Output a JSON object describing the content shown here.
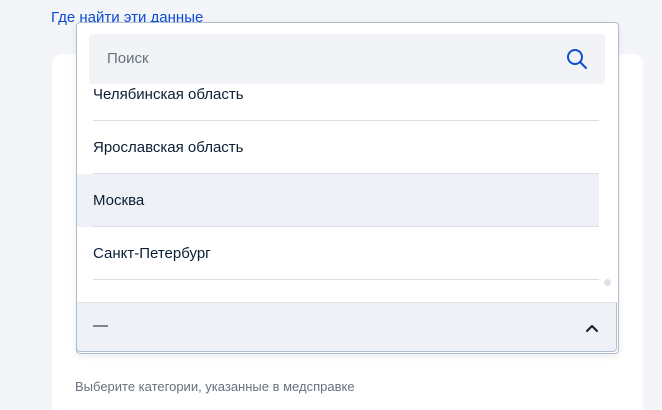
{
  "top_link": {
    "label": "Где найти эти данные"
  },
  "search": {
    "placeholder": "Поиск",
    "icon": "search-icon"
  },
  "list": {
    "items": [
      {
        "label": "Челябинская область"
      },
      {
        "label": "Ярославская область"
      },
      {
        "label": "Москва",
        "hovered": true
      },
      {
        "label": "Санкт-Петербург"
      }
    ]
  },
  "select": {
    "value": "—",
    "icon": "chevron-up-icon"
  },
  "hint": {
    "text": "Выберите категории, указанные в медсправке"
  },
  "colors": {
    "link": "#0d4cd3",
    "text": "#0b1f33",
    "muted": "#66727f",
    "border": "#b0bfd0",
    "hover_bg": "#eef1f5"
  }
}
